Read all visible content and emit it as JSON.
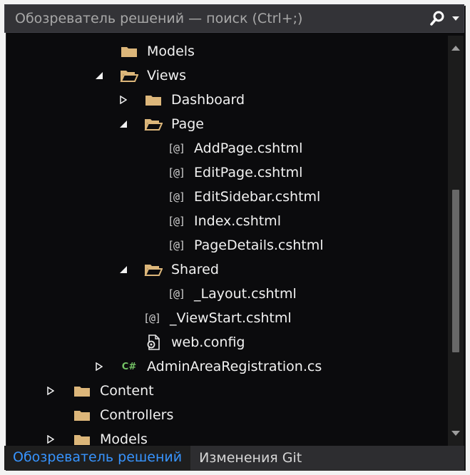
{
  "search": {
    "placeholder": "Обозреватель решений — поиск (Ctrl+;)",
    "icon": "search-icon",
    "dropdown_icon": "chevron-down-icon"
  },
  "tree": {
    "items": [
      {
        "label": "Models",
        "type": "folder",
        "expander": "none"
      },
      {
        "label": "Views",
        "type": "folder-open",
        "expander": "expanded"
      },
      {
        "label": "Dashboard",
        "type": "folder",
        "expander": "collapsed"
      },
      {
        "label": "Page",
        "type": "folder-open",
        "expander": "expanded"
      },
      {
        "label": "AddPage.cshtml",
        "type": "cshtml",
        "expander": "none"
      },
      {
        "label": "EditPage.cshtml",
        "type": "cshtml",
        "expander": "none"
      },
      {
        "label": "EditSidebar.cshtml",
        "type": "cshtml",
        "expander": "none"
      },
      {
        "label": "Index.cshtml",
        "type": "cshtml",
        "expander": "none"
      },
      {
        "label": "PageDetails.cshtml",
        "type": "cshtml",
        "expander": "none"
      },
      {
        "label": "Shared",
        "type": "folder-open",
        "expander": "expanded"
      },
      {
        "label": "_Layout.cshtml",
        "type": "cshtml",
        "expander": "none"
      },
      {
        "label": "_ViewStart.cshtml",
        "type": "cshtml",
        "expander": "none"
      },
      {
        "label": "web.config",
        "type": "config",
        "expander": "none"
      },
      {
        "label": "AdminAreaRegistration.cs",
        "type": "csharp",
        "expander": "collapsed"
      },
      {
        "label": "Content",
        "type": "folder",
        "expander": "collapsed"
      },
      {
        "label": "Controllers",
        "type": "folder",
        "expander": "none"
      },
      {
        "label": "Models",
        "type": "folder",
        "expander": "collapsed"
      }
    ],
    "cshtml_glyph": "[@]",
    "csharp_glyph": "C#"
  },
  "tabs": [
    {
      "label": "Обозреватель решений",
      "active": true
    },
    {
      "label": "Изменения Git",
      "active": false
    }
  ],
  "colors": {
    "background": "#0b0b0d",
    "folder": "#dcb67a",
    "active_tab_text": "#3794ff",
    "csharp": "#74c365"
  }
}
